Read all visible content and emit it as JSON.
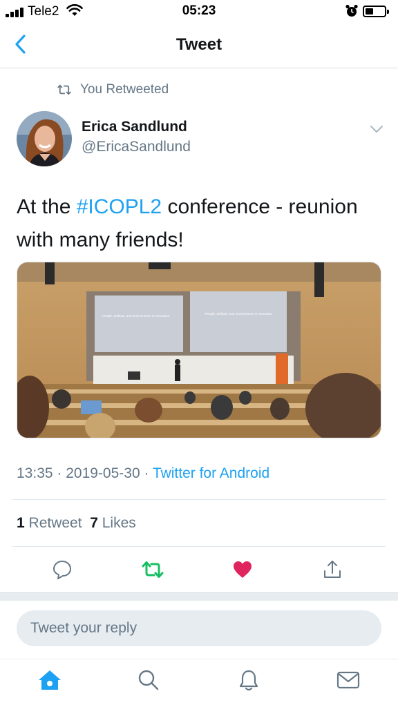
{
  "status_bar": {
    "carrier": "Tele2",
    "time": "05:23"
  },
  "nav": {
    "title": "Tweet"
  },
  "retweet_banner": {
    "label": "You Retweeted"
  },
  "tweet": {
    "author_name": "Erica Sandlund",
    "author_handle": "@EricaSandlund",
    "text_before": "At the ",
    "hashtag": "#ICOPL2",
    "text_after": " conference - reunion with many friends!",
    "photo_slides": {
      "left_title": "People, artifacts, and environments in interaction",
      "right_title": "People, artifacts, and environments in interaction"
    },
    "timestamp": "13:35 · 2019-05-30 · ",
    "source": "Twitter for Android",
    "retweet_count": "1",
    "retweet_label": " Retweet  ",
    "like_count": "7",
    "like_label": " Likes"
  },
  "reply": {
    "placeholder": "Tweet your reply"
  },
  "colors": {
    "accent": "#1da1f2",
    "retweet_green": "#17bf63",
    "like_red": "#e0245e",
    "secondary_text": "#657786"
  },
  "icons": {
    "back": "chevron-left-icon",
    "retweet_banner": "retweet-icon",
    "caret": "chevron-down-icon",
    "reply": "comment-icon",
    "retweet": "retweet-icon",
    "like": "heart-icon",
    "share": "share-icon",
    "home": "home-icon",
    "search": "search-icon",
    "notifications": "bell-icon",
    "messages": "mail-icon"
  }
}
